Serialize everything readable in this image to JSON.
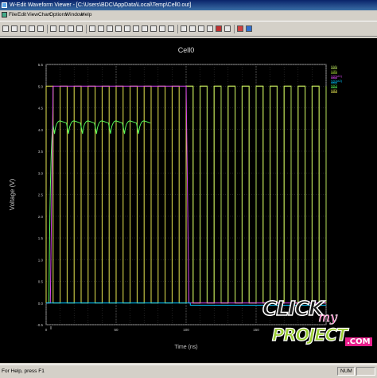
{
  "window": {
    "title": "W-Edit Waveform Viewer - [C:\\Users\\BDC\\AppData\\Local\\Temp\\Cell0.out]"
  },
  "menu": [
    "File",
    "Edit",
    "View",
    "Chart",
    "Options",
    "Window",
    "Help"
  ],
  "toolbar": {
    "buttons": [
      "new-icon",
      "open-icon",
      "save-icon",
      "print-icon",
      "print-preview-icon",
      "cut-icon",
      "copy-icon",
      "paste-icon",
      "undo-icon",
      "zoom-in-icon",
      "zoom-out-icon",
      "zoom-fit-icon",
      "pan-icon",
      "cursor-icon",
      "measure-icon",
      "grid-icon",
      "legend-icon",
      "chart-icon",
      "trace-icon",
      "expand-icon",
      "rewind-icon",
      "play-icon",
      "pause-icon",
      "stop-icon",
      "fast-forward-icon",
      "config-icon",
      "help-icon"
    ]
  },
  "colors": {
    "plot_bg": "#000000",
    "grid": "#404040",
    "frame": "#9a9a9a",
    "text": "#c8c8c8",
    "v_in": "#9acd32",
    "v_out_low": "#00c8ff",
    "v_magenta": "#d946ef",
    "v_green": "#5aff5a",
    "v_yellow": "#e6e650"
  },
  "chart_data": {
    "type": "line",
    "title": "Cell0",
    "xlabel": "Time (ns)",
    "ylabel": "Voltage (V)",
    "xlim": [
      0,
      200
    ],
    "ylim": [
      -0.5,
      5.5
    ],
    "xticks": [
      "0",
      "50",
      "100",
      "150"
    ],
    "yticks": [
      "-0.5",
      "0.0",
      "0.5",
      "1.0",
      "1.5",
      "2.0",
      "2.5",
      "3.0",
      "3.5",
      "4.0",
      "4.5",
      "5.0",
      "5.5"
    ],
    "grid": true,
    "legend": [
      "V(A)",
      "V(B)",
      "V(Out1)",
      "V(Out2)",
      "V(C)",
      "V(D)"
    ],
    "legend_position": "top-right",
    "series": [
      {
        "color": "yellow",
        "clock_period": 10,
        "duty": 0.5,
        "high": 5.0,
        "low": 0.0,
        "start": 0,
        "end": 200
      },
      {
        "color": "magenta",
        "points": [
          [
            0,
            0
          ],
          [
            3,
            0
          ],
          [
            5,
            5
          ],
          [
            100,
            5
          ],
          [
            102,
            0
          ],
          [
            200,
            0
          ]
        ]
      },
      {
        "color": "cyan",
        "points": [
          [
            0,
            0
          ],
          [
            100,
            0
          ],
          [
            103,
            0
          ],
          [
            103,
            -0.05
          ],
          [
            200,
            -0.05
          ]
        ]
      },
      {
        "color": "green_bumps",
        "period": 10,
        "peak": 4.2,
        "start": 5,
        "end": 70
      },
      {
        "color": "light_green",
        "period": 10,
        "high": 5.0,
        "low": 0.0,
        "start": 100,
        "end": 200
      }
    ]
  },
  "watermark": {
    "line1": "CLICK",
    "line2": "my",
    "line3": "PROJECT",
    "line4": ".COM"
  },
  "status": {
    "left": "For Help, press F1",
    "right": "NUM"
  }
}
